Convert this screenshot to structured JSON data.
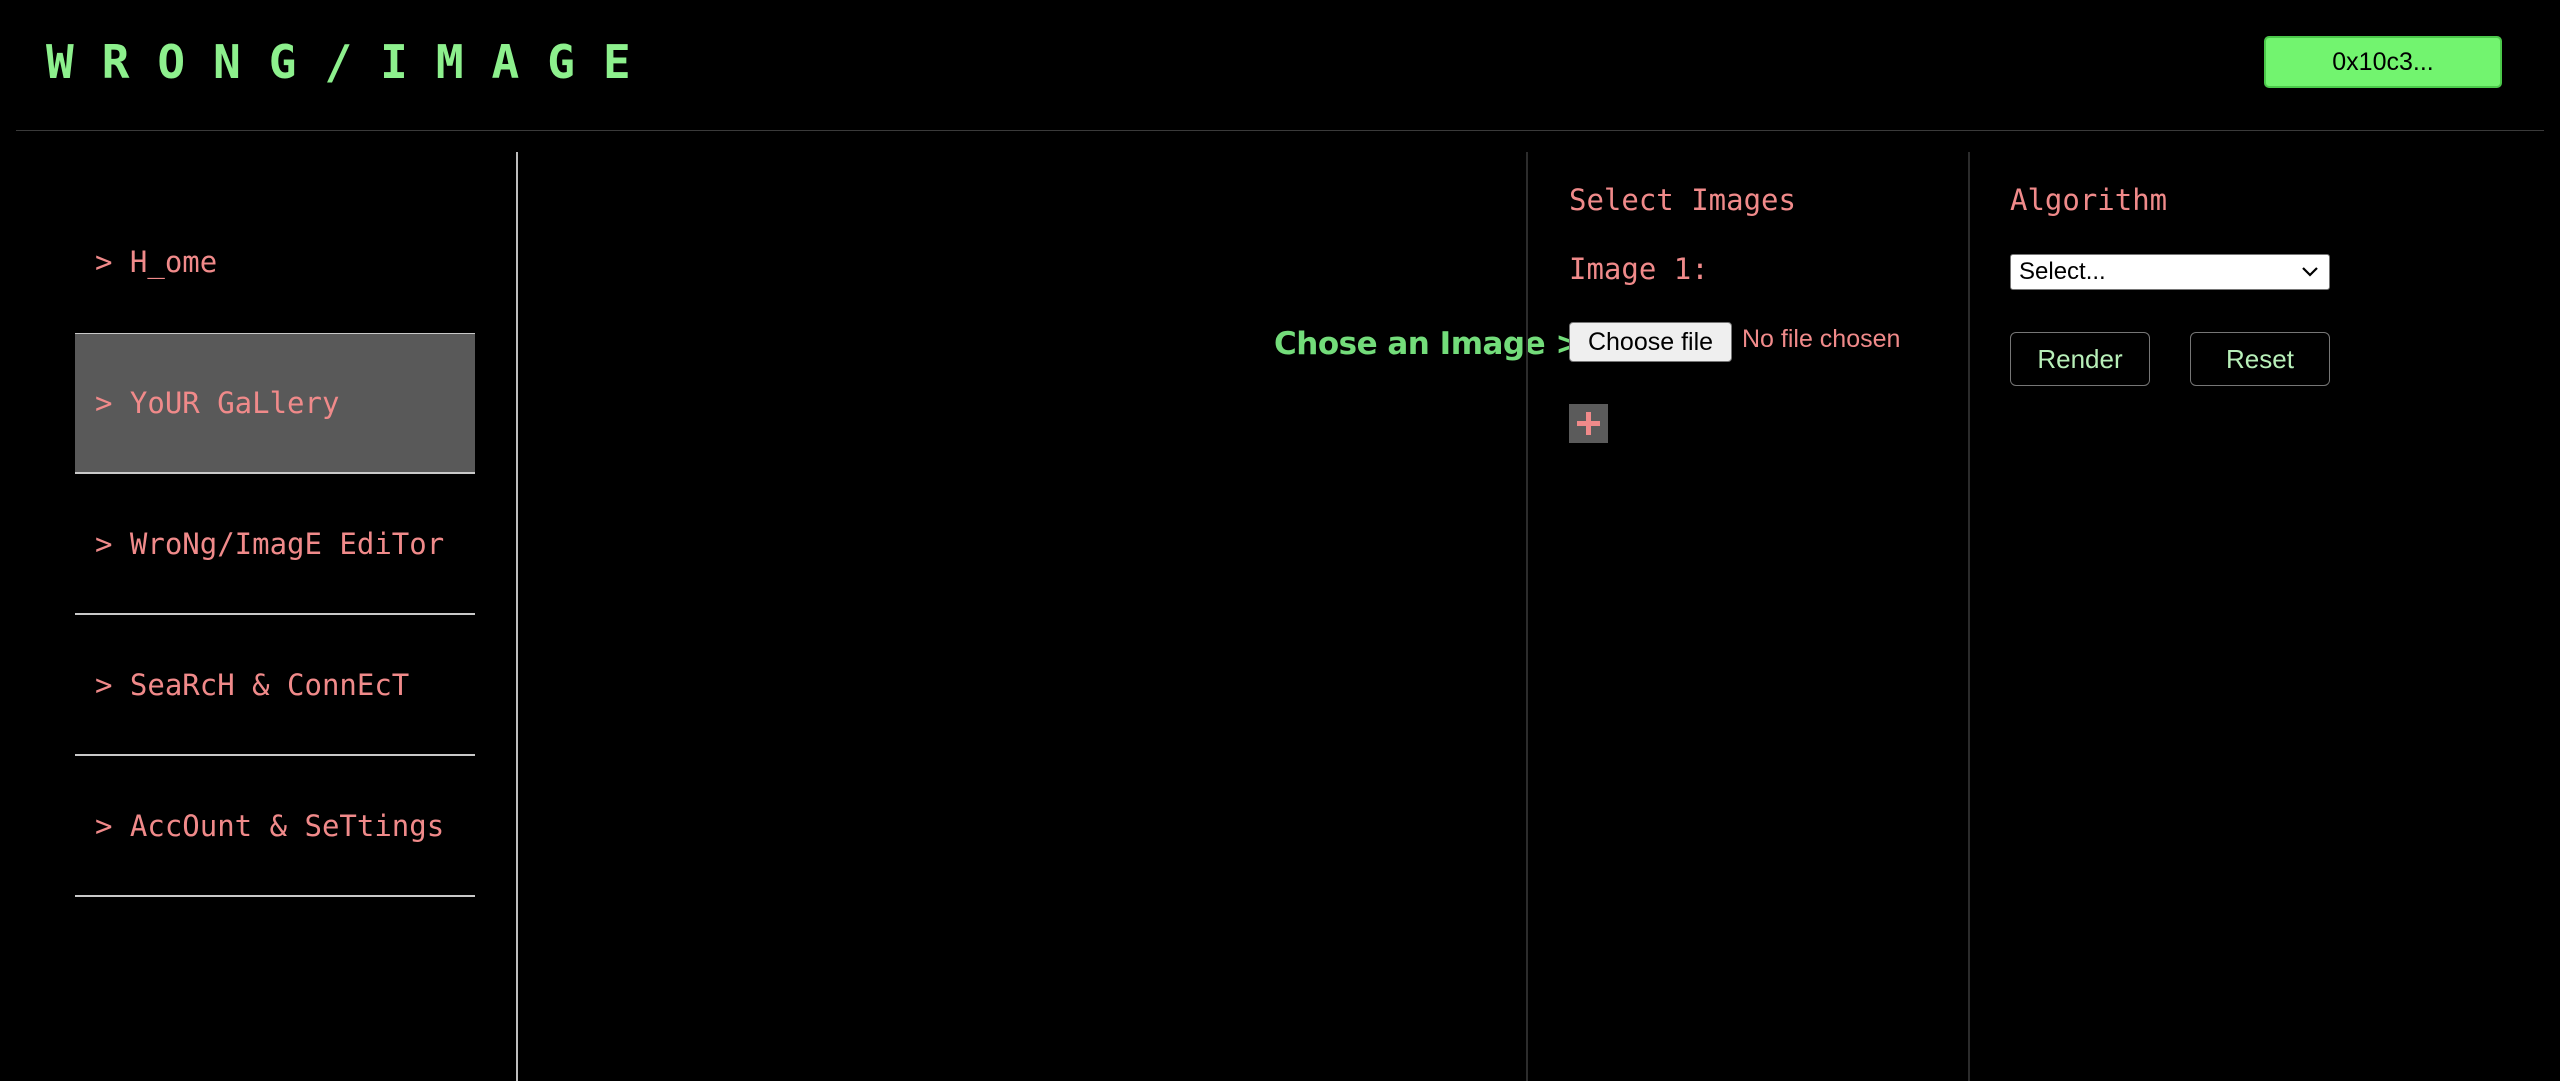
{
  "header": {
    "brand": "WRONG/IMAGE",
    "wallet_address": "0x10c3..."
  },
  "sidebar": {
    "items": [
      {
        "label": "> H_ome",
        "active": false
      },
      {
        "label": "> YoUR GaLlery",
        "active": true
      },
      {
        "label": "> WroNg/ImagE EdiTor",
        "active": false
      },
      {
        "label": "> SeaRcH & ConnEcT",
        "active": false
      },
      {
        "label": "> AccOunt & SeTtings",
        "active": false
      }
    ]
  },
  "main": {
    "choose_prompt": "Chose an Image >"
  },
  "select_images": {
    "title": "Select Images",
    "image_label": "Image 1:",
    "file_button_label": "Choose file",
    "file_status": "No file chosen",
    "add_icon": "plus-icon"
  },
  "algorithm": {
    "title": "Algorithm",
    "selected": "Select...",
    "render_label": "Render",
    "reset_label": "Reset"
  },
  "colors": {
    "brand_green": "#8df08d",
    "accent_pink": "#f08a8a",
    "wallet_green": "#72f46f",
    "active_nav_bg": "#595959"
  }
}
